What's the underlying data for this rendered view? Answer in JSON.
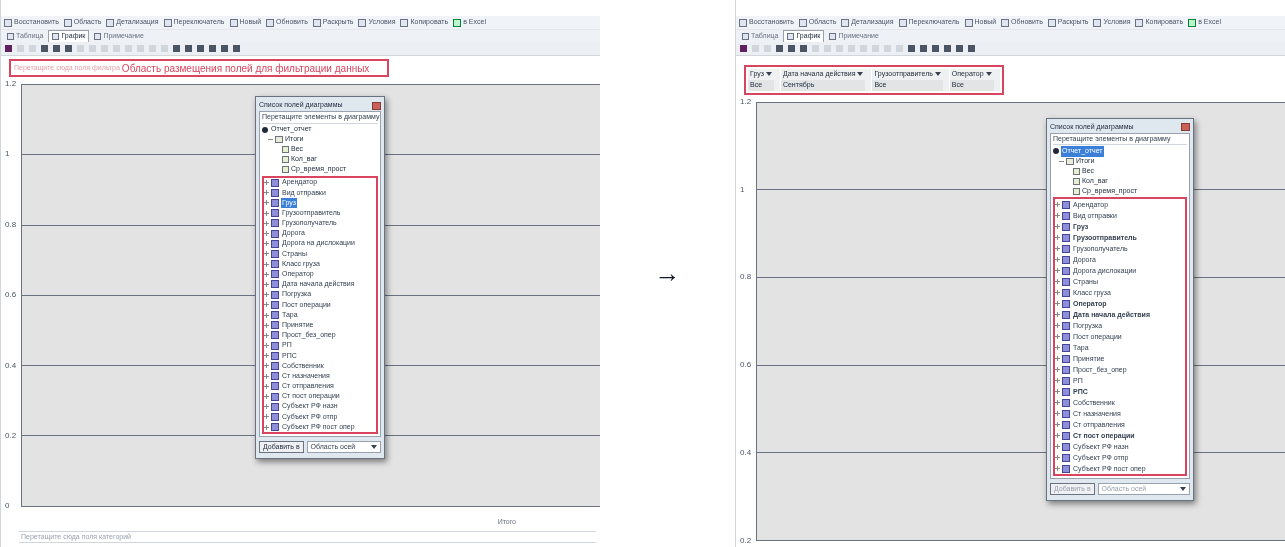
{
  "windows": [
    {
      "toolbar": [
        "Восстановить",
        "Область",
        "Детализация",
        "Переключатель",
        "Новый",
        "Обновить",
        "Раскрыть",
        "Условия",
        "Копировать",
        "в Excel"
      ],
      "tabs": [
        {
          "label": "Таблица",
          "selected": false
        },
        {
          "label": "График",
          "selected": true
        },
        {
          "label": "Примечание",
          "selected": false
        }
      ],
      "filter_area": {
        "kind": "hint",
        "hint": "Перетащите сюда поля фильтра",
        "caption": "Область размещения полей для фильтрации данных"
      },
      "y_ticks": [
        "1.2",
        "1",
        "0.8",
        "0.6",
        "0.4",
        "0.2",
        "0"
      ],
      "x_label": "Итого",
      "category_hint": "Перетащите сюда поля категорий",
      "field_list": {
        "title": "Список полей диаграммы",
        "hint": "Перетащите элементы в диаграмму",
        "root": {
          "label": "Отчет_отчет",
          "selected": false
        },
        "totals": {
          "label": "Итоги",
          "expanded": true,
          "children": [
            "Вес",
            "Кол_ваг",
            "Ср_время_прост"
          ]
        },
        "fields": [
          {
            "label": "Арендатор",
            "bold": false,
            "selected": false
          },
          {
            "label": "Вид отправки",
            "bold": false,
            "selected": false
          },
          {
            "label": "Груз",
            "bold": false,
            "selected": true
          },
          {
            "label": "Грузоотправитель",
            "bold": false,
            "selected": false
          },
          {
            "label": "Грузополучатель",
            "bold": false,
            "selected": false
          },
          {
            "label": "Дорога",
            "bold": false,
            "selected": false
          },
          {
            "label": "Дорога на дислокации",
            "bold": false,
            "selected": false
          },
          {
            "label": "Страны",
            "bold": false,
            "selected": false
          },
          {
            "label": "Класс груза",
            "bold": false,
            "selected": false
          },
          {
            "label": "Оператор",
            "bold": false,
            "selected": false
          },
          {
            "label": "Дата начала действия",
            "bold": false,
            "selected": false
          },
          {
            "label": "Погрузка",
            "bold": false,
            "selected": false
          },
          {
            "label": "Пост операции",
            "bold": false,
            "selected": false
          },
          {
            "label": "Тара",
            "bold": false,
            "selected": false
          },
          {
            "label": "Принятие",
            "bold": false,
            "selected": false
          },
          {
            "label": "Прост_без_опер",
            "bold": false,
            "selected": false
          },
          {
            "label": "РП",
            "bold": false,
            "selected": false
          },
          {
            "label": "РПС",
            "bold": false,
            "selected": false
          },
          {
            "label": "Собственник",
            "bold": false,
            "selected": false
          },
          {
            "label": "Ст назначения",
            "bold": false,
            "selected": false
          },
          {
            "label": "Ст отправления",
            "bold": false,
            "selected": false
          },
          {
            "label": "Ст пост операции",
            "bold": false,
            "selected": false
          },
          {
            "label": "Субъект РФ назн",
            "bold": false,
            "selected": false
          },
          {
            "label": "Субъект РФ отпр",
            "bold": false,
            "selected": false
          },
          {
            "label": "Субъект РФ пост опер",
            "bold": false,
            "selected": false
          }
        ],
        "add_button": {
          "label": "Добавить в",
          "disabled": false
        },
        "area_select": {
          "value": "Область осей",
          "disabled": false
        }
      }
    },
    {
      "toolbar": [
        "Восстановить",
        "Область",
        "Детализация",
        "Переключатель",
        "Новый",
        "Обновить",
        "Раскрыть",
        "Условия",
        "Копировать",
        "в Excel"
      ],
      "tabs": [
        {
          "label": "Таблица",
          "selected": false
        },
        {
          "label": "График",
          "selected": true
        },
        {
          "label": "Примечание",
          "selected": false
        }
      ],
      "filter_area": {
        "kind": "fields",
        "fields": [
          {
            "name": "Груз",
            "value": "Все"
          },
          {
            "name": "Дата начала действия",
            "value": "Сентябрь"
          },
          {
            "name": "Грузоотправитель",
            "value": "Все"
          },
          {
            "name": "Оператор",
            "value": "Все"
          }
        ]
      },
      "y_ticks": [
        "1.2",
        "1",
        "0.8",
        "0.6",
        "0.4",
        "0.2"
      ],
      "field_list": {
        "title": "Список полей диаграммы",
        "hint": "Перетащите элементы в диаграмму",
        "root": {
          "label": "Отчет_отчет",
          "selected": true
        },
        "totals": {
          "label": "Итоги",
          "expanded": true,
          "children": [
            "Вес",
            "Кол_ваг",
            "Ср_время_прост"
          ]
        },
        "fields": [
          {
            "label": "Арендатор",
            "bold": false,
            "selected": false
          },
          {
            "label": "Вид отправки",
            "bold": false,
            "selected": false
          },
          {
            "label": "Груз",
            "bold": true,
            "selected": false
          },
          {
            "label": "Грузоотправитель",
            "bold": true,
            "selected": false
          },
          {
            "label": "Грузополучатель",
            "bold": false,
            "selected": false
          },
          {
            "label": "Дорога",
            "bold": false,
            "selected": false
          },
          {
            "label": "Дорога дислокации",
            "bold": false,
            "selected": false
          },
          {
            "label": "Страны",
            "bold": false,
            "selected": false
          },
          {
            "label": "Класс груза",
            "bold": false,
            "selected": false
          },
          {
            "label": "Оператор",
            "bold": true,
            "selected": false
          },
          {
            "label": "Дата начала действия",
            "bold": true,
            "selected": false
          },
          {
            "label": "Погрузка",
            "bold": false,
            "selected": false
          },
          {
            "label": "Пост операции",
            "bold": false,
            "selected": false
          },
          {
            "label": "Тара",
            "bold": false,
            "selected": false
          },
          {
            "label": "Принятие",
            "bold": false,
            "selected": false
          },
          {
            "label": "Прост_без_опер",
            "bold": false,
            "selected": false
          },
          {
            "label": "РП",
            "bold": false,
            "selected": false
          },
          {
            "label": "РПС",
            "bold": true,
            "selected": false
          },
          {
            "label": "Собственник",
            "bold": false,
            "selected": false
          },
          {
            "label": "Ст назначения",
            "bold": false,
            "selected": false
          },
          {
            "label": "Ст отправления",
            "bold": false,
            "selected": false
          },
          {
            "label": "Ст пост операции",
            "bold": true,
            "selected": false
          },
          {
            "label": "Субъект РФ назн",
            "bold": false,
            "selected": false
          },
          {
            "label": "Субъект РФ отпр",
            "bold": false,
            "selected": false
          },
          {
            "label": "Субъект РФ пост опер",
            "bold": false,
            "selected": false
          }
        ],
        "add_button": {
          "label": "Добавить в",
          "disabled": true
        },
        "area_select": {
          "value": "Область осей",
          "disabled": true
        }
      }
    }
  ],
  "arrow": "→"
}
